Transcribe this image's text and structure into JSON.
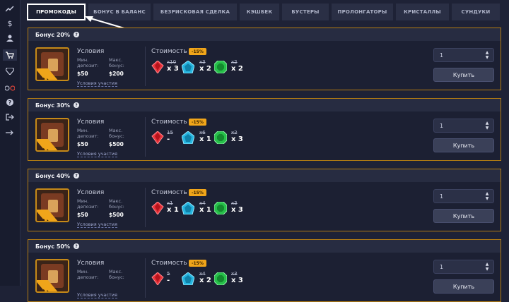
{
  "sidebar": {
    "icons": [
      "chart-line-icon",
      "dollar-icon",
      "user-icon",
      "cart-icon",
      "diamond-icon",
      "bike-icon",
      "question-icon",
      "sign-out-icon",
      "arrow-right-icon"
    ]
  },
  "tabs": [
    {
      "label": "ПРОМОКОДЫ",
      "active": true
    },
    {
      "label": "БОНУС В БАЛАНС",
      "active": false
    },
    {
      "label": "БЕЗРИСКОВАЯ СДЕЛКА",
      "active": false
    },
    {
      "label": "КЭШБЕК",
      "active": false
    },
    {
      "label": "БУСТЕРЫ",
      "active": false
    },
    {
      "label": "ПРОЛОНГАТОРЫ",
      "active": false
    },
    {
      "label": "КРИСТАЛЛЫ",
      "active": false
    },
    {
      "label": "СУНДУКИ",
      "active": false
    }
  ],
  "labels": {
    "conditions": "Условия",
    "min_deposit": "Мин.\nдепозит:",
    "max_bonus": "Макс.\nбонус:",
    "conditions_link": "Условия участия",
    "cost": "Стоимость",
    "buy": "Купить",
    "help": "?"
  },
  "colors": {
    "accent": "#f0a51a",
    "card_border": "#b37c12",
    "red_crystal": "#e8323a",
    "blue_crystal": "#26b6e0",
    "green_crystal": "#27c04a"
  },
  "cards": [
    {
      "title": "Бонус 20%",
      "discount": "-15%",
      "ribbon": "-15%",
      "min_deposit": "$50",
      "max_bonus": "$200",
      "red": {
        "old": "x10",
        "qty": "x 3"
      },
      "blue": {
        "old": "x3",
        "qty": "x 2"
      },
      "green": {
        "old": "x2",
        "qty": "x 2"
      },
      "quantity": "1"
    },
    {
      "title": "Бонус 30%",
      "discount": "-15%",
      "ribbon": "-15%",
      "min_deposit": "$50",
      "max_bonus": "$500",
      "red": {
        "old": "15",
        "qty": "-"
      },
      "blue": {
        "old": "x6",
        "qty": "x 1"
      },
      "green": {
        "old": "x2",
        "qty": "x 3"
      },
      "quantity": "1"
    },
    {
      "title": "Бонус 40%",
      "discount": "-15%",
      "ribbon": "-15%",
      "min_deposit": "$50",
      "max_bonus": "$500",
      "red": {
        "old": "x1",
        "qty": "x 1"
      },
      "blue": {
        "old": "x4",
        "qty": "x 1"
      },
      "green": {
        "old": "x3",
        "qty": "x 3"
      },
      "quantity": "1"
    },
    {
      "title": "Бонус 50%",
      "discount": "-15%",
      "ribbon": "-15%",
      "min_deposit": "",
      "max_bonus": "",
      "red": {
        "old": "5",
        "qty": "-"
      },
      "blue": {
        "old": "x4",
        "qty": "x 2"
      },
      "green": {
        "old": "x3",
        "qty": "x 3"
      },
      "quantity": "1"
    }
  ]
}
